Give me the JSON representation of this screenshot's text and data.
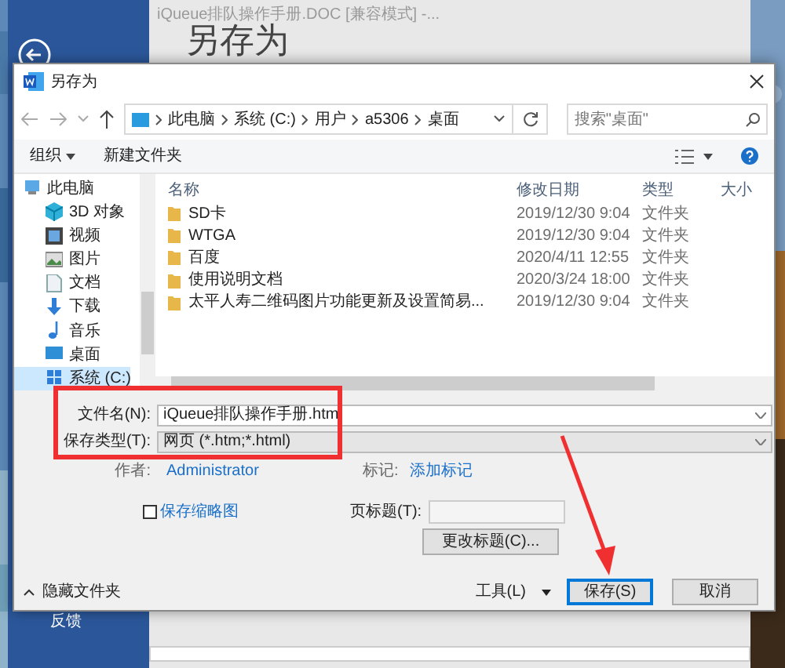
{
  "background_window": {
    "title": "iQueue排队操作手册.DOC [兼容模式] -...",
    "heading": "另存为",
    "sidebar_items": [
      "反馈"
    ]
  },
  "dialog": {
    "title": "另存为",
    "breadcrumb": [
      "此电脑",
      "系统 (C:)",
      "用户",
      "a5306",
      "桌面"
    ],
    "search": {
      "placeholder": "搜索\"桌面\""
    },
    "toolbar": [
      {
        "label": "组织",
        "dropdown": true
      },
      {
        "label": "新建文件夹",
        "dropdown": false
      }
    ],
    "nav_items": [
      {
        "label": "此电脑",
        "kind": "pc",
        "selected": false
      },
      {
        "label": "3D 对象",
        "kind": "cube",
        "selected": false
      },
      {
        "label": "视频",
        "kind": "video",
        "selected": false
      },
      {
        "label": "图片",
        "kind": "pictures",
        "selected": false
      },
      {
        "label": "文档",
        "kind": "documents",
        "selected": false
      },
      {
        "label": "下载",
        "kind": "downloads",
        "selected": false
      },
      {
        "label": "音乐",
        "kind": "music",
        "selected": false
      },
      {
        "label": "桌面",
        "kind": "desktop",
        "selected": false
      },
      {
        "label": "系统 (C:)",
        "kind": "drive",
        "selected": true
      }
    ],
    "columns": [
      "名称",
      "修改日期",
      "类型",
      "大小"
    ],
    "rows": [
      {
        "name": "SD卡",
        "date": "2019/12/30 9:04",
        "type": "文件夹"
      },
      {
        "name": "WTGA",
        "date": "2019/12/30 9:04",
        "type": "文件夹"
      },
      {
        "name": "百度",
        "date": "2020/4/11 12:55",
        "type": "文件夹"
      },
      {
        "name": "使用说明文档",
        "date": "2020/3/24 18:00",
        "type": "文件夹"
      },
      {
        "name": "太平人寿二维码图片功能更新及设置简易...",
        "date": "2019/12/30 9:04",
        "type": "文件夹"
      }
    ],
    "file_name": {
      "label": "文件名(N):",
      "value": "iQueue排队操作手册.htm"
    },
    "save_type": {
      "label": "保存类型(T):",
      "value": "网页 (*.htm;*.html)"
    },
    "author": {
      "label": "作者:",
      "value": "Administrator"
    },
    "tags": {
      "label": "标记:",
      "value": "添加标记"
    },
    "thumbnail": {
      "label": "保存缩略图",
      "checked": false
    },
    "page_title": {
      "label": "页标题(T):"
    },
    "change_title_button": "更改标题(C)...",
    "hide_folders": "隐藏文件夹",
    "tools": "工具(L)",
    "buttons": [
      {
        "label": "保存(S)",
        "default": true
      },
      {
        "label": "取消",
        "default": false
      }
    ]
  }
}
